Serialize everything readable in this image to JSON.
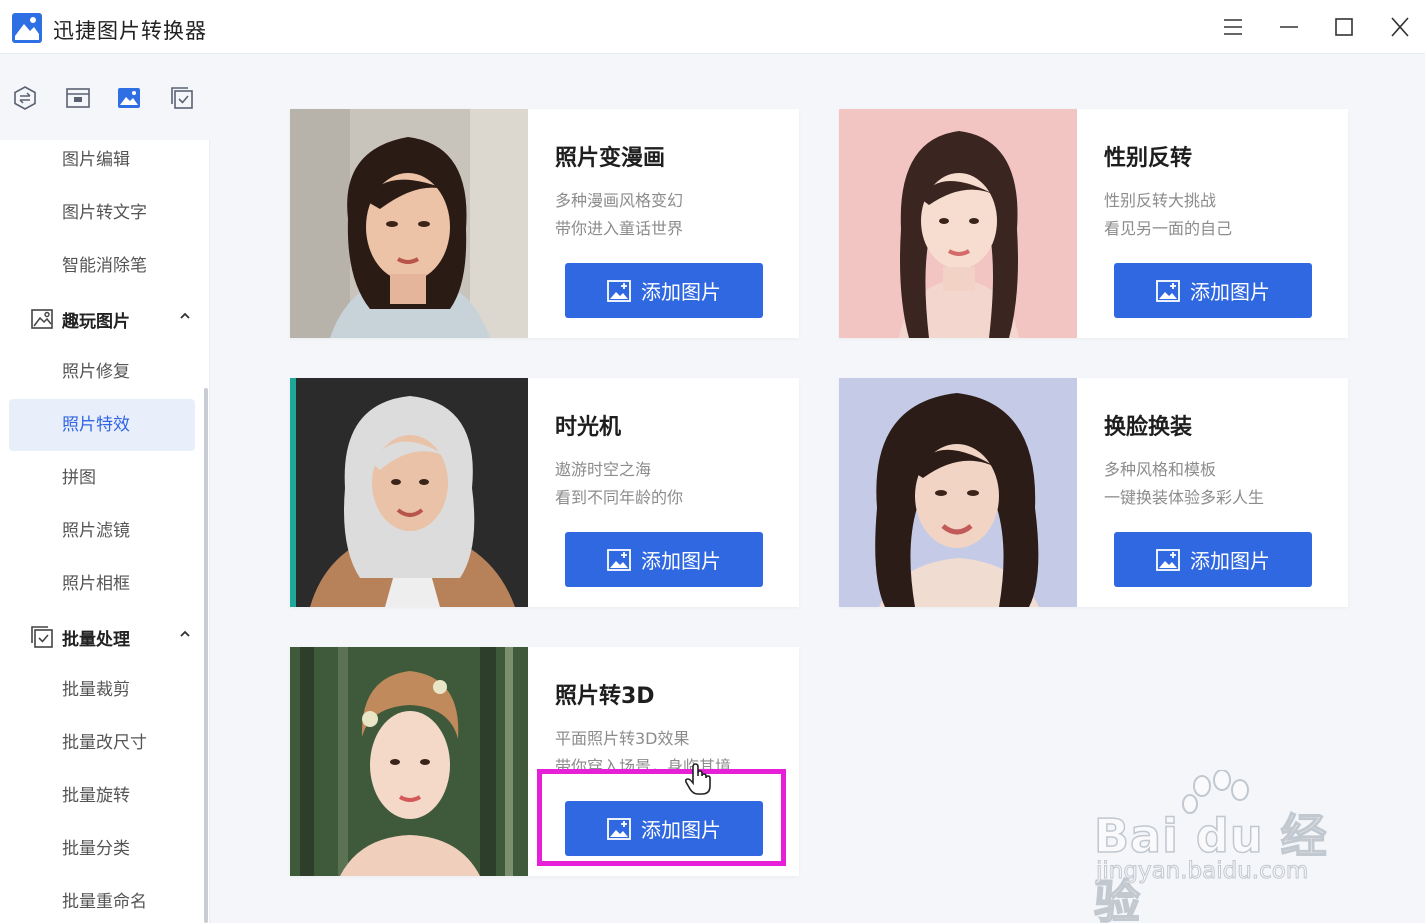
{
  "app": {
    "title": "迅捷图片转换器"
  },
  "sidebar": {
    "items_top": [
      "图片编辑",
      "图片转文字",
      "智能消除笔"
    ],
    "group_fun": {
      "label": "趣玩图片"
    },
    "items_fun": [
      "照片修复",
      "照片特效",
      "拼图",
      "照片滤镜",
      "照片相框"
    ],
    "active_item": "照片特效",
    "group_batch": {
      "label": "批量处理"
    },
    "items_batch": [
      "批量裁剪",
      "批量改尺寸",
      "批量旋转",
      "批量分类",
      "批量重命名"
    ]
  },
  "cards": [
    {
      "title": "照片变漫画",
      "desc1": "多种漫画风格变幻",
      "desc2": "带你进入童话世界",
      "button": "添加图片"
    },
    {
      "title": "性别反转",
      "desc1": "性别反转大挑战",
      "desc2": "看见另一面的自己",
      "button": "添加图片"
    },
    {
      "title": "时光机",
      "desc1": "遨游时空之海",
      "desc2": "看到不同年龄的你",
      "button": "添加图片"
    },
    {
      "title": "换脸换装",
      "desc1": "多种风格和模板",
      "desc2": "一键换装体验多彩人生",
      "button": "添加图片"
    },
    {
      "title": "照片转3D",
      "desc1": "平面照片转3D效果",
      "desc2": "带你穿入场景，身临其境",
      "button": "添加图片"
    }
  ],
  "watermark": {
    "line1": "Bai du 经验",
    "line2": "jingyan.baidu.com"
  },
  "colors": {
    "accent": "#2f68e0",
    "active_text": "#3266e5",
    "highlight": "#e520d6"
  }
}
